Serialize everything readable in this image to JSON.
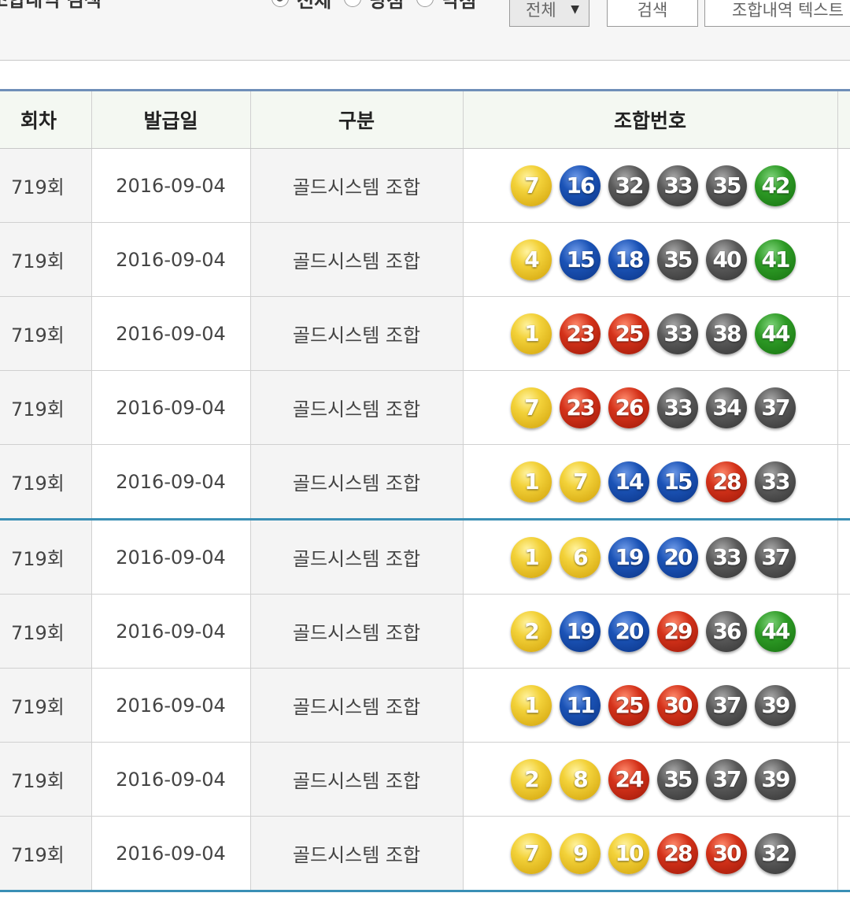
{
  "search": {
    "title": "조합내역 검색",
    "radio_options": [
      {
        "label": "전체",
        "checked": true
      },
      {
        "label": "당첨",
        "checked": false
      },
      {
        "label": "낙첨",
        "checked": false
      }
    ],
    "select_value": "전체",
    "search_button": "검색",
    "text_button": "조합내역 텍스트"
  },
  "table": {
    "headers": [
      "회차",
      "발급일",
      "구분",
      "조합번호"
    ],
    "rows": [
      {
        "round": "719회",
        "date": "2016-09-04",
        "kind": "골드시스템 조합",
        "balls": [
          7,
          16,
          32,
          33,
          35,
          42
        ]
      },
      {
        "round": "719회",
        "date": "2016-09-04",
        "kind": "골드시스템 조합",
        "balls": [
          4,
          15,
          18,
          35,
          40,
          41
        ]
      },
      {
        "round": "719회",
        "date": "2016-09-04",
        "kind": "골드시스템 조합",
        "balls": [
          1,
          23,
          25,
          33,
          38,
          44
        ]
      },
      {
        "round": "719회",
        "date": "2016-09-04",
        "kind": "골드시스템 조합",
        "balls": [
          7,
          23,
          26,
          33,
          34,
          37
        ]
      },
      {
        "round": "719회",
        "date": "2016-09-04",
        "kind": "골드시스템 조합",
        "balls": [
          1,
          7,
          14,
          15,
          28,
          33
        ]
      },
      {
        "round": "719회",
        "date": "2016-09-04",
        "kind": "골드시스템 조합",
        "balls": [
          1,
          6,
          19,
          20,
          33,
          37
        ]
      },
      {
        "round": "719회",
        "date": "2016-09-04",
        "kind": "골드시스템 조합",
        "balls": [
          2,
          19,
          20,
          29,
          36,
          44
        ]
      },
      {
        "round": "719회",
        "date": "2016-09-04",
        "kind": "골드시스템 조합",
        "balls": [
          1,
          11,
          25,
          30,
          37,
          39
        ]
      },
      {
        "round": "719회",
        "date": "2016-09-04",
        "kind": "골드시스템 조합",
        "balls": [
          2,
          8,
          24,
          35,
          37,
          39
        ]
      },
      {
        "round": "719회",
        "date": "2016-09-04",
        "kind": "골드시스템 조합",
        "balls": [
          7,
          9,
          10,
          28,
          30,
          32
        ]
      }
    ]
  },
  "ball_colors": {
    "1-10": "#e0b416",
    "11-20": "#1b53b6",
    "21-30": "#d4321a",
    "31-40": "#5a5a5a",
    "41-45": "#2d9a25"
  }
}
